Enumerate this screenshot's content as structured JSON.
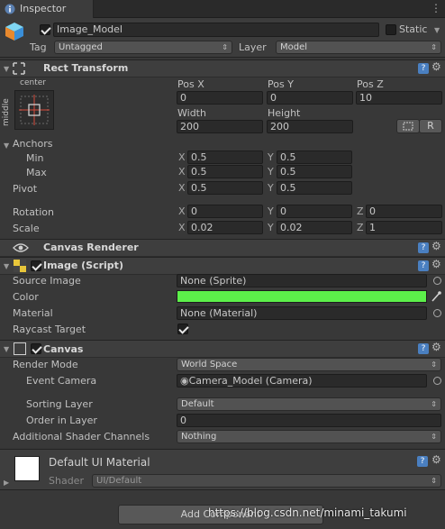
{
  "tab": {
    "label": "Inspector"
  },
  "gameobject": {
    "name": "Image_Model",
    "static_label": "Static",
    "tag_label": "Tag",
    "tag_value": "Untagged",
    "layer_label": "Layer",
    "layer_value": "Model"
  },
  "rect_transform": {
    "title": "Rect Transform",
    "anchor_h": "center",
    "anchor_v": "middle",
    "posx_label": "Pos X",
    "posy_label": "Pos Y",
    "posz_label": "Pos Z",
    "posx": "0",
    "posy": "0",
    "posz": "10",
    "width_label": "Width",
    "height_label": "Height",
    "width": "200",
    "height": "200",
    "r_button": "R",
    "anchors_label": "Anchors",
    "min_label": "Min",
    "min_x": "0.5",
    "min_y": "0.5",
    "max_label": "Max",
    "max_x": "0.5",
    "max_y": "0.5",
    "pivot_label": "Pivot",
    "pivot_x": "0.5",
    "pivot_y": "0.5",
    "rotation_label": "Rotation",
    "rot_x": "0",
    "rot_y": "0",
    "rot_z": "0",
    "scale_label": "Scale",
    "scale_x": "0.02",
    "scale_y": "0.02",
    "scale_z": "1",
    "x": "X",
    "y": "Y",
    "z": "Z"
  },
  "canvas_renderer": {
    "title": "Canvas Renderer"
  },
  "image_script": {
    "title": "Image (Script)",
    "source_label": "Source Image",
    "source_value": "None (Sprite)",
    "color_label": "Color",
    "color_value": "#5cf04a",
    "material_label": "Material",
    "material_value": "None (Material)",
    "raycast_label": "Raycast Target"
  },
  "canvas": {
    "title": "Canvas",
    "render_mode_label": "Render Mode",
    "render_mode_value": "World Space",
    "event_camera_label": "Event Camera",
    "event_camera_value": "Camera_Model (Camera)",
    "sorting_layer_label": "Sorting Layer",
    "sorting_layer_value": "Default",
    "order_label": "Order in Layer",
    "order_value": "0",
    "shader_channels_label": "Additional Shader Channels",
    "shader_channels_value": "Nothing"
  },
  "material": {
    "title": "Default UI Material",
    "shader_label": "Shader",
    "shader_value": "UI/Default"
  },
  "add_component": "Add Component",
  "watermark": "https://blog.csdn.net/minami_takumi"
}
